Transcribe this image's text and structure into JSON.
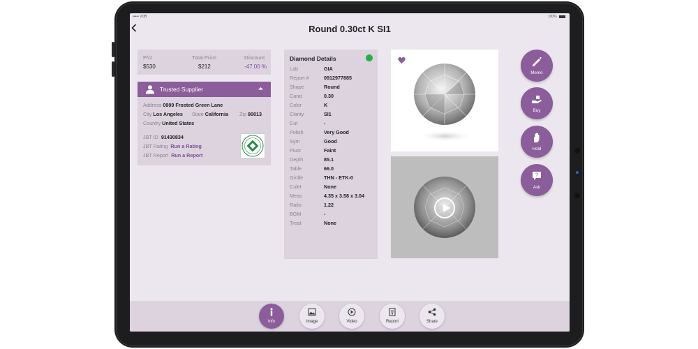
{
  "status": {
    "carrier": "••••• VDB",
    "battery": "100%"
  },
  "header": {
    "title": "Round 0.30ct K SI1"
  },
  "pricing": {
    "pct_label": "P/ct",
    "pct_value": "$530",
    "total_label": "Total Price",
    "total_value": "$212",
    "discount_label": "Discount",
    "discount_value": "-47.00 %",
    "discount_color": "#7e4d93"
  },
  "supplier": {
    "title": "Trusted Supplier",
    "address_label": "Address",
    "address": "0909 Frosted Green Lane",
    "city_label": "City",
    "city": "Los Angeles",
    "state_label": "State",
    "state": "California",
    "zip_label": "Zip",
    "zip": "90013",
    "country_label": "Country",
    "country": "United States",
    "jbt_id_label": "JBT ID",
    "jbt_id": "91430834",
    "jbt_rating_label": "JBT Rating",
    "jbt_rating_link": "Run a Rating",
    "jbt_report_label": "JBT Report",
    "jbt_report_link": "Run a Report"
  },
  "details": {
    "title": "Diamond Details",
    "status_color": "#21b04b",
    "rows": [
      {
        "k": "Lab",
        "v": "GIA"
      },
      {
        "k": "Report #",
        "v": "0912977885"
      },
      {
        "k": "Shape",
        "v": "Round"
      },
      {
        "k": "Carat",
        "v": "0.30"
      },
      {
        "k": "Color",
        "v": "K"
      },
      {
        "k": "Clarity",
        "v": "SI1"
      },
      {
        "k": "Cut",
        "v": "-"
      },
      {
        "k": "Polish",
        "v": "Very Good"
      },
      {
        "k": "Sym",
        "v": "Good"
      },
      {
        "k": "Fluor",
        "v": "Faint"
      },
      {
        "k": "Depth",
        "v": "85.1"
      },
      {
        "k": "Table",
        "v": "66.0"
      },
      {
        "k": "Girdle",
        "v": "THN - ETK-0"
      },
      {
        "k": "Culet",
        "v": "None"
      },
      {
        "k": "Meas",
        "v": "4.35 x 3.58 x 3.04"
      },
      {
        "k": "Ratio",
        "v": "1.22"
      },
      {
        "k": "BGM",
        "v": "-"
      },
      {
        "k": "Treat",
        "v": "None"
      }
    ]
  },
  "actions": [
    {
      "label": "Memo",
      "icon": "memo-icon"
    },
    {
      "label": "Buy",
      "icon": "buy-icon"
    },
    {
      "label": "Hold",
      "icon": "hold-icon"
    },
    {
      "label": "Ask",
      "icon": "ask-icon"
    }
  ],
  "tabs": [
    {
      "label": "Info",
      "icon": "info-icon",
      "active": true
    },
    {
      "label": "Image",
      "icon": "image-icon",
      "active": false
    },
    {
      "label": "Video",
      "icon": "video-icon",
      "active": false
    },
    {
      "label": "Report",
      "icon": "report-icon",
      "active": false
    },
    {
      "label": "Share",
      "icon": "share-icon",
      "active": false
    }
  ],
  "colors": {
    "accent": "#8b5e9b",
    "panel": "#dcd3df",
    "background": "#ece7ee"
  }
}
